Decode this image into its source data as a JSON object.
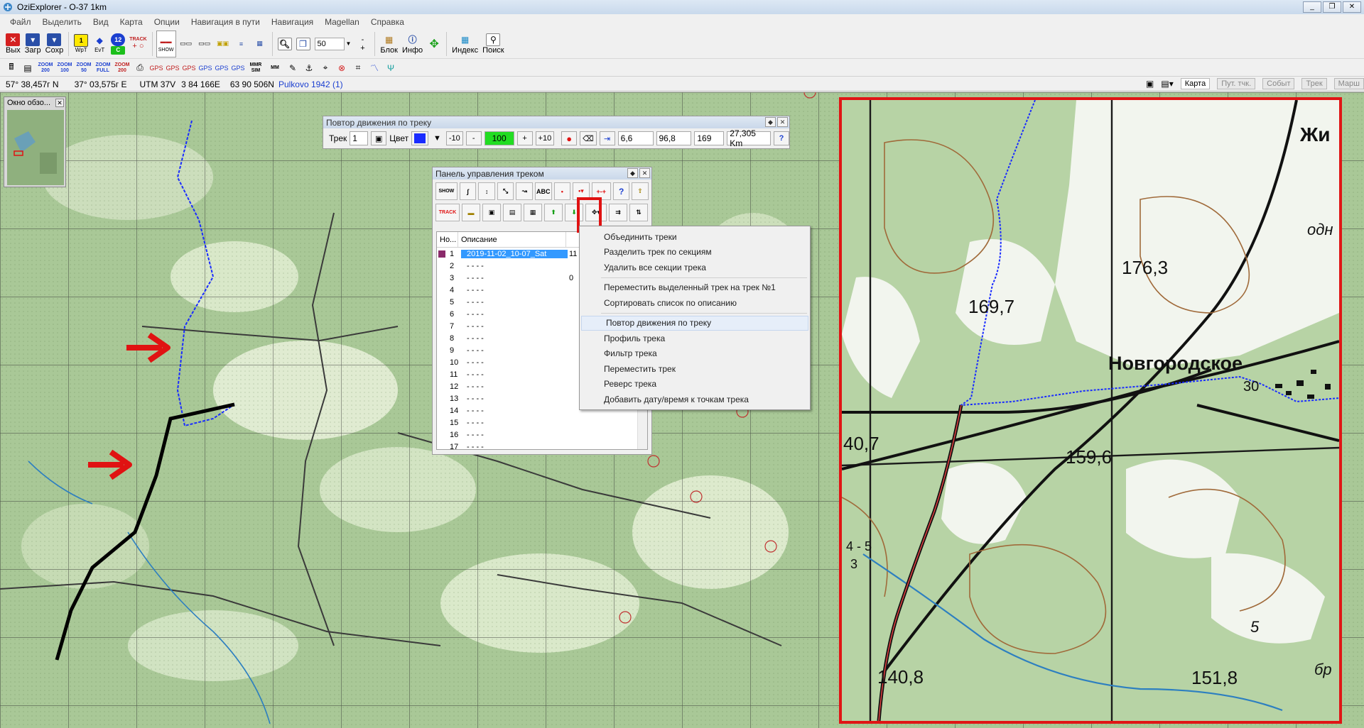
{
  "window": {
    "title": "OziExplorer - O-37 1km",
    "min": "_",
    "max": "❐",
    "close": "✕"
  },
  "menu": [
    "Файл",
    "Выделить",
    "Вид",
    "Карта",
    "Опции",
    "Навигация в пути",
    "Навигация",
    "Magellan",
    "Справка"
  ],
  "toolbar": {
    "exit": "Вых",
    "load": "Загр",
    "save": "Сохр",
    "wpt": "WpT",
    "evt": "EvT",
    "zoom_value": "50",
    "block": "Блок",
    "info": "Инфо",
    "index": "Индекс",
    "search": "Поиск",
    "track": "TRACK",
    "show": "SHOW"
  },
  "toolbar2": {
    "z1": "ZOOM 200",
    "z2": "ZOOM 100",
    "z3": "ZOOM 50",
    "z4": "ZOOM FULL",
    "z5": "ZOOM 200",
    "mm": "MM",
    "mmr": "MMR SIM"
  },
  "status": {
    "lat": "57° 38,457г N",
    "lon": "37° 03,575г E",
    "utm": "UTM  37V",
    "easting": "3 84 166E",
    "northing": "63 90 506N",
    "datum": "Pulkovo 1942 (1)"
  },
  "tabs": [
    "Карта",
    "Пут. тчк.",
    "Событ",
    "Трек",
    "Марш"
  ],
  "overview": {
    "title": "Окно обзо..."
  },
  "replay": {
    "title": "Повтор движения по треку",
    "track_label": "Трек",
    "track_num": "1",
    "color_label": "Цвет",
    "minus10": "-10",
    "minus": "-",
    "speed": "100",
    "plus": "+",
    "plus10": "+10",
    "v1": "6,6",
    "v2": "96,8",
    "v3": "169",
    "dist": "27,305 Km",
    "help": "?"
  },
  "trackpanel": {
    "title": "Панель управления треком",
    "col_no": "Но...",
    "col_desc": "Описание",
    "col_extra": "",
    "rows": [
      {
        "n": "1",
        "desc": "2019-11-02_10-07_Sat",
        "x": "11"
      },
      {
        "n": "2",
        "desc": "- - - -",
        "x": ""
      },
      {
        "n": "3",
        "desc": "- - - -",
        "x": "0"
      },
      {
        "n": "4",
        "desc": "- - - -",
        "x": ""
      },
      {
        "n": "5",
        "desc": "- - - -",
        "x": ""
      },
      {
        "n": "6",
        "desc": "- - - -",
        "x": ""
      },
      {
        "n": "7",
        "desc": "- - - -",
        "x": ""
      },
      {
        "n": "8",
        "desc": "- - - -",
        "x": ""
      },
      {
        "n": "9",
        "desc": "- - - -",
        "x": ""
      },
      {
        "n": "10",
        "desc": "- - - -",
        "x": ""
      },
      {
        "n": "11",
        "desc": "- - - -",
        "x": ""
      },
      {
        "n": "12",
        "desc": "- - - -",
        "x": ""
      },
      {
        "n": "13",
        "desc": "- - - -",
        "x": ""
      },
      {
        "n": "14",
        "desc": "- - - -",
        "x": ""
      },
      {
        "n": "15",
        "desc": "- - - -",
        "x": ""
      },
      {
        "n": "16",
        "desc": "- - - -",
        "x": ""
      },
      {
        "n": "17",
        "desc": "- - - -",
        "x": ""
      }
    ]
  },
  "context_menu": {
    "items": [
      "Объединить треки",
      "Разделить трек по секциям",
      "Удалить все секции трека"
    ],
    "items2": [
      "Переместить выделенный трек на трек №1",
      "Сортировать список по описанию"
    ],
    "items3": [
      "Повтор движения по треку",
      "Профиль трека",
      "Фильтр трека",
      "Переместить трек",
      "Реверс трека",
      "Добавить дату/время к точкам трека"
    ]
  },
  "map_labels": {
    "novgorodskoe": "Новгородское",
    "h1763": "176,3",
    "h1697": "169,7",
    "h1596": "159,6",
    "h1408": "140,8",
    "h1518": "151,8",
    "h407": "40,7",
    "zhi": "Жи",
    "odn": "одн",
    "br": "бр",
    "n5": "5",
    "n45": "4 - 5",
    "n3": "3",
    "n30": "30"
  },
  "colors": {
    "accent_red": "#e01212",
    "track_blue": "#1a2cff",
    "selection": "#3399ff",
    "speed_green": "#22dd22"
  }
}
